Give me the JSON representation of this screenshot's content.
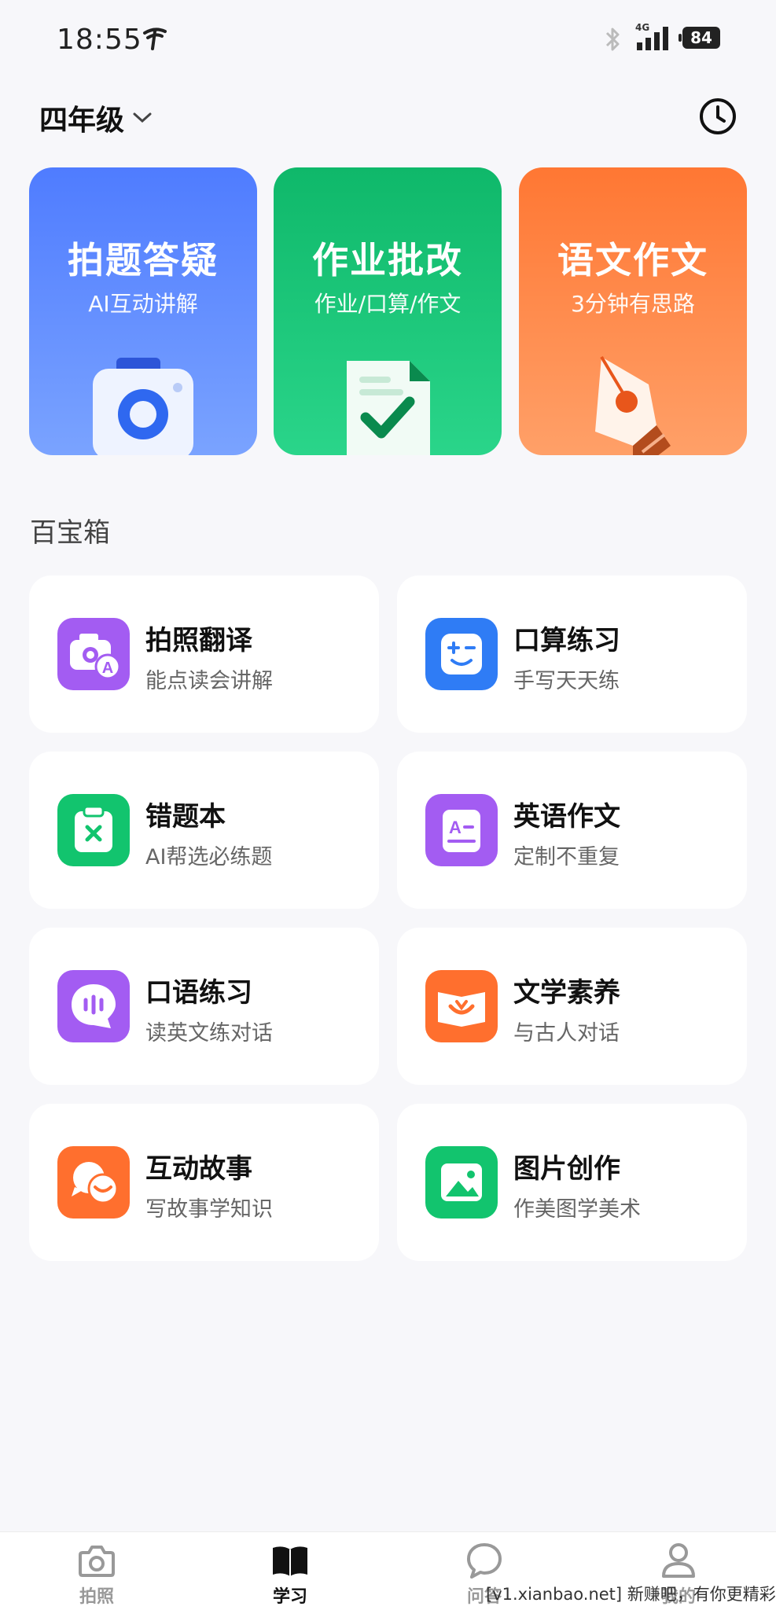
{
  "status_bar": {
    "time": "18:55",
    "network": "4G",
    "battery": "84"
  },
  "header": {
    "grade": "四年级"
  },
  "feature_cards": [
    {
      "title": "拍题答疑",
      "subtitle": "AI互动讲解"
    },
    {
      "title": "作业批改",
      "subtitle": "作业/口算/作文"
    },
    {
      "title": "语文作文",
      "subtitle": "3分钟有思路"
    }
  ],
  "toolbox": {
    "title": "百宝箱",
    "items": [
      {
        "title": "拍照翻译",
        "subtitle": "能点读会讲解",
        "icon": "camera-translate-icon"
      },
      {
        "title": "口算练习",
        "subtitle": "手写天天练",
        "icon": "math-face-icon"
      },
      {
        "title": "错题本",
        "subtitle": "AI帮选必练题",
        "icon": "clipboard-x-icon"
      },
      {
        "title": "英语作文",
        "subtitle": "定制不重复",
        "icon": "essay-a-icon"
      },
      {
        "title": "口语练习",
        "subtitle": "读英文练对话",
        "icon": "speech-bubble-icon"
      },
      {
        "title": "文学素养",
        "subtitle": "与古人对话",
        "icon": "open-book-icon"
      },
      {
        "title": "互动故事",
        "subtitle": "写故事学知识",
        "icon": "chat-smile-icon"
      },
      {
        "title": "图片创作",
        "subtitle": "作美图学美术",
        "icon": "picture-icon"
      }
    ]
  },
  "bottom_nav": {
    "items": [
      {
        "label": "拍照",
        "icon": "camera-icon",
        "active": false
      },
      {
        "label": "学习",
        "icon": "book-icon",
        "active": true
      },
      {
        "label": "问答",
        "icon": "chat-icon",
        "active": false
      },
      {
        "label": "我的",
        "icon": "person-icon",
        "active": false
      }
    ]
  },
  "watermark": "[v1.xianbao.net] 新赚吧，有你更精彩！",
  "colors": {
    "blue_card": "#4f7cff",
    "green_card": "#0fb86a",
    "orange_card": "#ff7733",
    "purple_icon": "#a35cf2",
    "blue_icon": "#2f7cf5",
    "green_icon": "#12c46e",
    "orange_icon": "#ff6f2e"
  }
}
